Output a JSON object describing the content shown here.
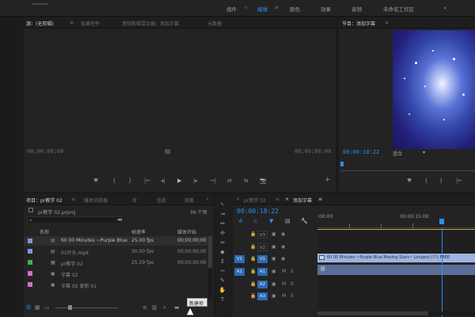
{
  "top_menu": {
    "items": [
      "组件",
      "编辑",
      "颜色",
      "效果",
      "音频",
      "未命名工作区"
    ],
    "active_index": 1
  },
  "source_panel": {
    "tabs": [
      "源：(无剪辑)",
      "效果控件",
      "音频剪辑混合器：添加字幕",
      "元数据"
    ],
    "tab_menu": "≡",
    "timecode_left": "00;00;00;00",
    "timecode_right": "00;00;00;00",
    "center_icon": "▤",
    "controls": [
      "♥",
      "{",
      "}",
      "|←",
      "◂|",
      "▶",
      "|▸",
      "→|",
      "⇄",
      "⇆",
      "📷"
    ],
    "plus": "+"
  },
  "program_panel": {
    "tab": "节目：添加字幕",
    "tab_menu": "≡",
    "timecode": "00:00:18:22",
    "fit_label": "适合",
    "fit_arrow": "▾",
    "controls": [
      "♥",
      "{",
      "}",
      "|←"
    ]
  },
  "project_panel": {
    "tabs": [
      "项目：pr教学 02",
      "媒体浏览器",
      "库",
      "信息",
      "效果"
    ],
    "tab_menu": "≡",
    "more": "»",
    "project_file": "pr教学 02.prproj",
    "item_count": "39 个项",
    "columns": [
      "名称",
      "帧速率",
      "媒体开始"
    ],
    "rows": [
      {
        "name": "60 00 Minutes ~Purple Blue",
        "fps": "25.00 fps",
        "start": "00;00;00;00",
        "color": "#7d9ad8",
        "selected": true
      },
      {
        "name": "01片头.mp4",
        "fps": "30.00 fps",
        "start": "00;00;00;00",
        "color": "#7d9ad8",
        "selected": false
      },
      {
        "name": "pr教学 02",
        "fps": "25.29 fps",
        "start": "00;00;00;00",
        "color": "#3fb24a",
        "selected": false
      },
      {
        "name": "字幕 02",
        "fps": "",
        "start": "",
        "color": "#d670c8",
        "selected": false
      },
      {
        "name": "字幕 02 复制 01",
        "fps": "",
        "start": "",
        "color": "#d670c8",
        "selected": false
      }
    ],
    "tooltip": "新建项"
  },
  "timeline": {
    "tabs": [
      "pr教学 02",
      "添加字幕"
    ],
    "tab_menu": "≡",
    "close": "×",
    "timecode": "00:00:18:22",
    "ruler_labels": [
      ":00:00",
      "00:00:15:00"
    ],
    "tracks": [
      {
        "src": "",
        "name": "V3",
        "type": "video"
      },
      {
        "src": "",
        "name": "V2",
        "type": "video"
      },
      {
        "src": "V1",
        "name": "V1",
        "type": "video"
      },
      {
        "src": "A1",
        "name": "A1",
        "type": "audio"
      },
      {
        "src": "",
        "name": "A2",
        "type": "audio"
      },
      {
        "src": "",
        "name": "A3",
        "type": "audio"
      }
    ],
    "track_icons": {
      "lock": "🔒",
      "eye": "👁",
      "film": "▣",
      "m": "M",
      "s": "S"
    },
    "clip_label": "60 00 Minutes ~Purple Blue Moving Stars~ Longest (!!!) FREE",
    "audio_clip_label": "⛓"
  },
  "tools": [
    "↖",
    "⇥",
    "↔",
    "✣",
    "⇔",
    "◆",
    "↕",
    "⇿",
    "✎",
    "✋",
    "T"
  ]
}
